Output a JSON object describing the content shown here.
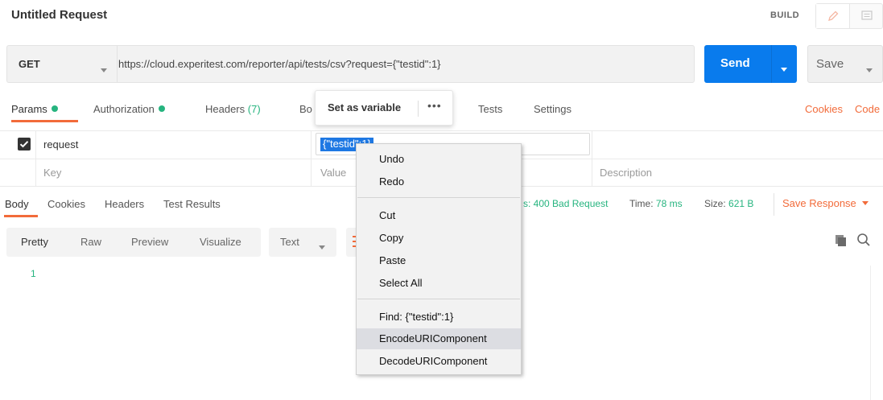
{
  "header": {
    "title": "Untitled Request",
    "build_label": "BUILD"
  },
  "request": {
    "method": "GET",
    "url": "https://cloud.experitest.com/reporter/api/tests/csv?request={\"testid\":1}",
    "send_label": "Send",
    "save_label": "Save"
  },
  "tabs": {
    "params": "Params",
    "authorization": "Authorization",
    "headers": "Headers",
    "headers_count": "(7)",
    "body_partial": "Bo",
    "tests": "Tests",
    "settings": "Settings",
    "cookies": "Cookies",
    "code": "Code"
  },
  "params": {
    "rows": [
      {
        "checked": true,
        "key": "request",
        "value": "{\"testid\":1}"
      }
    ],
    "placeholders": {
      "key": "Key",
      "value": "Value",
      "description": "Description"
    }
  },
  "popup": {
    "label": "Set as variable",
    "more": "•••"
  },
  "response": {
    "tabs": [
      "Body",
      "Cookies",
      "Headers",
      "Test Results"
    ],
    "status_partial": "s: 400 Bad Request",
    "time_label": "Time:",
    "time_value": "78 ms",
    "size_label": "Size:",
    "size_value": "621 B",
    "save_response": "Save Response",
    "format_buttons": [
      "Pretty",
      "Raw",
      "Preview",
      "Visualize"
    ],
    "format_select": "Text",
    "line_number": "1"
  },
  "context_menu": {
    "items": [
      "Undo",
      "Redo",
      "Cut",
      "Copy",
      "Paste",
      "Select All",
      "Find: {\"testid\":1}",
      "EncodeURIComponent",
      "DecodeURIComponent"
    ],
    "highlighted": "EncodeURIComponent"
  },
  "colors": {
    "accent": "#f26b3a",
    "primary": "#097bed",
    "success": "#26b47f"
  }
}
